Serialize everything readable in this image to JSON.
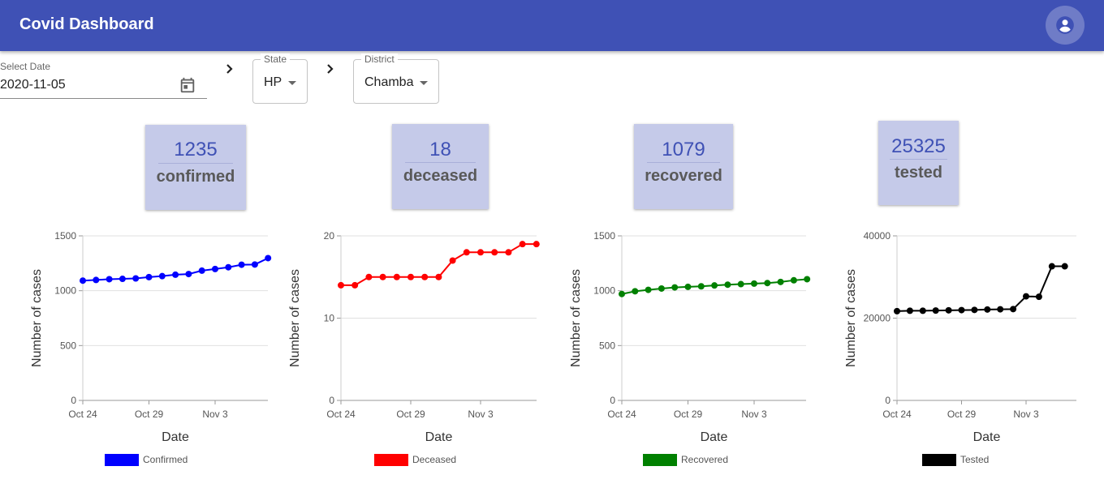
{
  "app": {
    "title": "Covid Dashboard"
  },
  "filters": {
    "date_label": "Select Date",
    "date_value": "2020-11-05",
    "state_label": "State",
    "state_value": "HP",
    "district_label": "District",
    "district_value": "Chamba"
  },
  "icons": [
    "account-circle-icon",
    "calendar-icon",
    "chevron-right-icon",
    "dropdown-arrow-icon"
  ],
  "stats": [
    {
      "value": "1235",
      "label": "confirmed"
    },
    {
      "value": "18",
      "label": "deceased"
    },
    {
      "value": "1079",
      "label": "recovered"
    },
    {
      "value": "25325",
      "label": "tested"
    }
  ],
  "colors": {
    "appbar": "#3f51b5",
    "card": "#c5cae9"
  },
  "chart_data": [
    {
      "type": "line",
      "xlabel": "Date",
      "ylabel": "Number of cases",
      "xticks": [
        {
          "day": 0,
          "label": "Oct 24"
        },
        {
          "day": 5,
          "label": "Oct 29"
        },
        {
          "day": 10,
          "label": "Nov 3"
        }
      ],
      "ylim": [
        0,
        1500
      ],
      "yticks": [
        0,
        500,
        1000,
        1500
      ],
      "series": [
        {
          "name": "Confirmed",
          "color": "#0000ff",
          "values": [
            1092,
            1098,
            1105,
            1108,
            1112,
            1124,
            1133,
            1146,
            1152,
            1183,
            1198,
            1214,
            1237,
            1239,
            1297
          ]
        }
      ]
    },
    {
      "type": "line",
      "xlabel": "Date",
      "ylabel": "Number of cases",
      "xticks": [
        {
          "day": 0,
          "label": "Oct 24"
        },
        {
          "day": 5,
          "label": "Oct 29"
        },
        {
          "day": 10,
          "label": "Nov 3"
        }
      ],
      "ylim": [
        0,
        20
      ],
      "yticks": [
        0,
        10,
        20
      ],
      "series": [
        {
          "name": "Deceased",
          "color": "#ff0000",
          "values": [
            14,
            14,
            15,
            15,
            15,
            15,
            15,
            15,
            17,
            18,
            18,
            18,
            18,
            19,
            19
          ]
        }
      ]
    },
    {
      "type": "line",
      "xlabel": "Date",
      "ylabel": "Number of cases",
      "xticks": [
        {
          "day": 0,
          "label": "Oct 24"
        },
        {
          "day": 5,
          "label": "Oct 29"
        },
        {
          "day": 10,
          "label": "Nov 3"
        }
      ],
      "ylim": [
        0,
        1500
      ],
      "yticks": [
        0,
        500,
        1000,
        1500
      ],
      "series": [
        {
          "name": "Recovered",
          "color": "#008000",
          "values": [
            970,
            995,
            1008,
            1020,
            1030,
            1035,
            1040,
            1048,
            1055,
            1060,
            1065,
            1070,
            1080,
            1095,
            1105
          ]
        }
      ]
    },
    {
      "type": "line",
      "xlabel": "Date",
      "ylabel": "Number of cases",
      "xticks": [
        {
          "day": 0,
          "label": "Oct 24"
        },
        {
          "day": 5,
          "label": "Oct 29"
        },
        {
          "day": 10,
          "label": "Nov 3"
        }
      ],
      "ylim": [
        0,
        40000
      ],
      "yticks": [
        0,
        20000,
        40000
      ],
      "series": [
        {
          "name": "Tested",
          "color": "#000000",
          "values": [
            21700,
            21800,
            21800,
            21850,
            21900,
            21950,
            22000,
            22100,
            22150,
            22200,
            25300,
            25200,
            32600,
            32600
          ]
        }
      ]
    }
  ]
}
